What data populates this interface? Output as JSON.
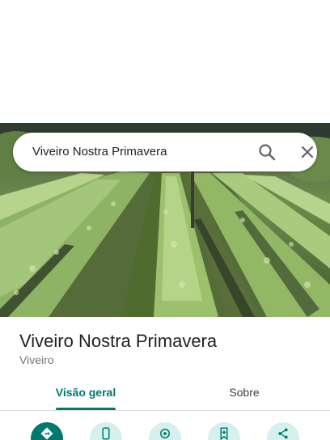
{
  "search": {
    "query": "Viveiro Nostra Primavera"
  },
  "place": {
    "name": "Viveiro Nostra Primavera",
    "category": "Viveiro"
  },
  "tabs": [
    {
      "label": "Visão geral",
      "selected": true
    },
    {
      "label": "Sobre",
      "selected": false
    }
  ],
  "actions": [
    {
      "icon": "directions-icon"
    },
    {
      "icon": "phone-icon"
    },
    {
      "icon": "location-pin-icon"
    },
    {
      "icon": "save-bookmark-icon"
    },
    {
      "icon": "share-icon"
    }
  ],
  "colors": {
    "accent": "#01796f",
    "accent_light": "#d6f0ee",
    "text_primary": "#202124",
    "text_secondary": "#70757a"
  }
}
